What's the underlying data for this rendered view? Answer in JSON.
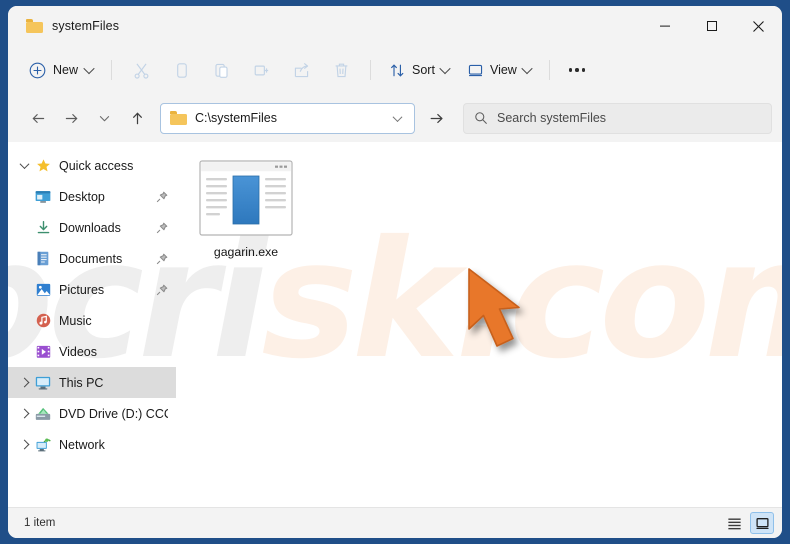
{
  "window": {
    "title": "systemFiles",
    "title_icon": "folder-icon",
    "controls": {
      "minimize": "minimize-icon",
      "maximize": "maximize-icon",
      "close": "close-icon"
    }
  },
  "toolbar": {
    "new_label": "New",
    "new_icon": "plus-circle-icon",
    "actions": [
      {
        "name": "cut",
        "icon": "scissors-icon",
        "enabled": false
      },
      {
        "name": "copy",
        "icon": "copy-icon",
        "enabled": false
      },
      {
        "name": "paste",
        "icon": "paste-icon",
        "enabled": false
      },
      {
        "name": "rename",
        "icon": "rename-icon",
        "enabled": false
      },
      {
        "name": "share",
        "icon": "share-icon",
        "enabled": false
      },
      {
        "name": "delete",
        "icon": "trash-icon",
        "enabled": false
      }
    ],
    "sort_label": "Sort",
    "sort_icon": "sort-arrows-icon",
    "view_label": "View",
    "view_icon": "monitor-icon",
    "overflow_label": "See more",
    "overflow_icon": "ellipsis-icon"
  },
  "address": {
    "back_icon": "arrow-left-icon",
    "forward_icon": "arrow-right-icon",
    "recent_icon": "chevron-down-icon",
    "up_icon": "arrow-up-icon",
    "path": "C:\\systemFiles",
    "path_icon": "folder-icon",
    "dropdown_icon": "chevron-down-icon",
    "refresh_icon": "arrow-right-icon"
  },
  "search": {
    "placeholder": "Search systemFiles",
    "icon": "search-icon"
  },
  "nav_pane": {
    "items": [
      {
        "label": "Quick access",
        "icon": "star-icon",
        "twisty": "down",
        "indent": false,
        "pinned": false,
        "selected": false
      },
      {
        "label": "Desktop",
        "icon": "desktop-icon",
        "twisty": "none",
        "indent": true,
        "pinned": true,
        "selected": false
      },
      {
        "label": "Downloads",
        "icon": "download-icon",
        "twisty": "none",
        "indent": true,
        "pinned": true,
        "selected": false
      },
      {
        "label": "Documents",
        "icon": "document-icon",
        "twisty": "none",
        "indent": true,
        "pinned": true,
        "selected": false
      },
      {
        "label": "Pictures",
        "icon": "pictures-icon",
        "twisty": "none",
        "indent": true,
        "pinned": true,
        "selected": false
      },
      {
        "label": "Music",
        "icon": "music-icon",
        "twisty": "none",
        "indent": true,
        "pinned": false,
        "selected": false
      },
      {
        "label": "Videos",
        "icon": "video-icon",
        "twisty": "none",
        "indent": true,
        "pinned": false,
        "selected": false
      },
      {
        "label": "This PC",
        "icon": "this-pc-icon",
        "twisty": "right",
        "indent": false,
        "pinned": false,
        "selected": true
      },
      {
        "label": "DVD Drive (D:) CCCC",
        "icon": "dvd-drive-icon",
        "twisty": "right",
        "indent": false,
        "pinned": false,
        "selected": false
      },
      {
        "label": "Network",
        "icon": "network-icon",
        "twisty": "right",
        "indent": false,
        "pinned": false,
        "selected": false
      }
    ]
  },
  "content": {
    "files": [
      {
        "name": "gagarin.exe",
        "icon": "application-window-icon"
      }
    ]
  },
  "status_bar": {
    "item_count": "1 item",
    "list_view_icon": "list-view-icon",
    "large_icons_view_icon": "large-icons-view-icon",
    "active_view": "large-icons"
  },
  "watermark": {
    "text_gray": "pcri",
    "text_orange": "sk.com"
  },
  "cursor": {
    "name": "mouse-pointer",
    "color": "#e8772a"
  },
  "colors": {
    "frame": "#1f4e88",
    "chrome": "#f3f3f3",
    "accent": "#0f6cbd",
    "selection": "#dcdcdc",
    "address_border": "#a8c3e0"
  }
}
